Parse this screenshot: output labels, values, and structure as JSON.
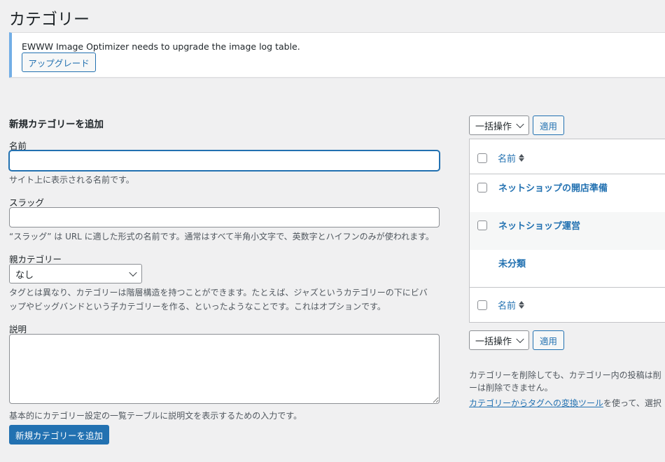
{
  "page": {
    "title": "カテゴリー"
  },
  "notice": {
    "message": "EWWW Image Optimizer needs to upgrade the image log table.",
    "button_label": "アップグレード"
  },
  "form": {
    "heading": "新規カテゴリーを追加",
    "name": {
      "label": "名前",
      "value": "",
      "description": "サイト上に表示される名前です。"
    },
    "slug": {
      "label": "スラッグ",
      "value": "",
      "description": "“スラッグ” は URL に適した形式の名前です。通常はすべて半角小文字で、英数字とハイフンのみが使われます。"
    },
    "parent": {
      "label": "親カテゴリー",
      "selected": "なし",
      "description_line1": "タグとは異なり、カテゴリーは階層構造を持つことができます。たとえば、ジャズというカテゴリーの下にビバ",
      "description_line2": "ップやビッグバンドという子カテゴリーを作る、といったようなことです。これはオプションです。"
    },
    "description": {
      "label": "説明",
      "value": "",
      "description": "基本的にカテゴリー設定の一覧テーブルに説明文を表示するための入力です。"
    },
    "submit_label": "新規カテゴリーを追加"
  },
  "list": {
    "bulk_action_label": "一括操作",
    "apply_label": "適用",
    "column_name": "名前",
    "rows": [
      {
        "name": "ネットショップの開店準備",
        "has_checkbox": true
      },
      {
        "name": "ネットショップ運営",
        "has_checkbox": true
      },
      {
        "name": "未分類",
        "has_checkbox": false
      }
    ]
  },
  "note": {
    "line1": "カテゴリーを削除しても、カテゴリー内の投稿は削",
    "line2": "ーは削除できません。",
    "link_text": "カテゴリーからタグへの変換ツール",
    "line3_rest": "を使って、選択"
  },
  "colors": {
    "accent": "#2271b1",
    "notice_border": "#72aee6",
    "background": "#f0f0f1"
  }
}
